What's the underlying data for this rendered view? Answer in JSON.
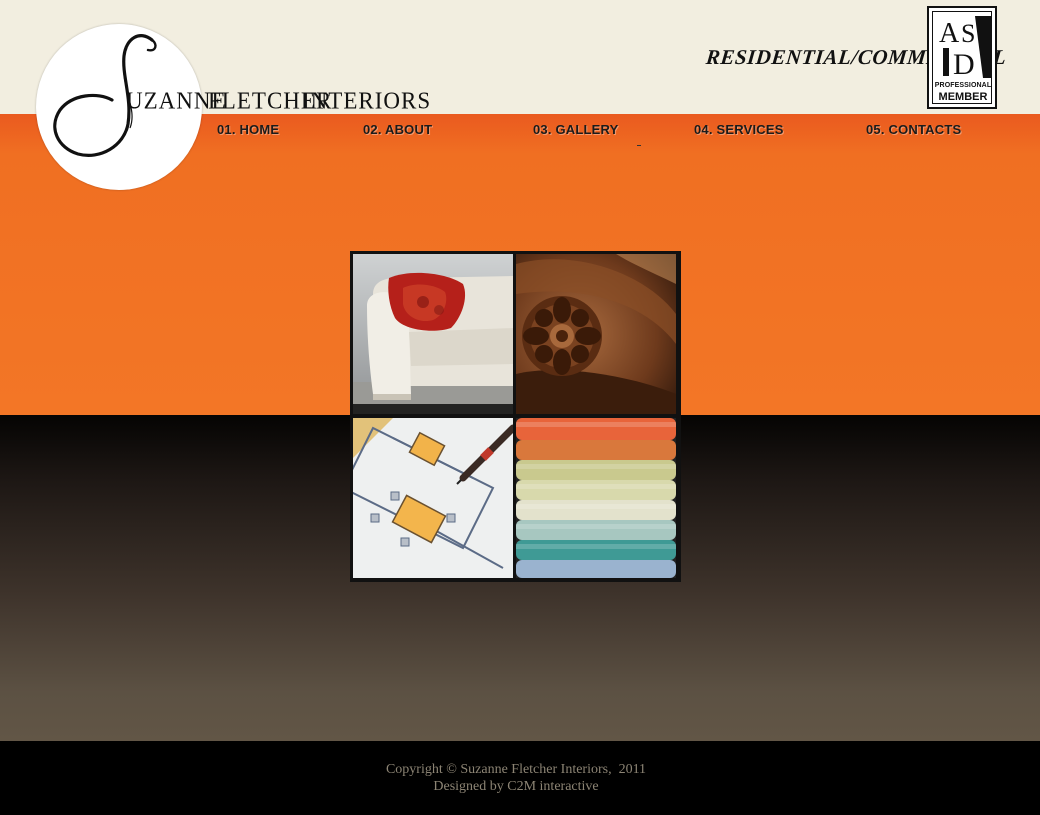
{
  "brand": {
    "word1": "UZANNE",
    "word2": "FLETCHER",
    "word3": "INTERIORS",
    "tagline": "RESIDENTIAL/COMMERCIAL",
    "badge_line1": "PROFESSIONAL",
    "badge_line2": "MEMBER"
  },
  "nav": {
    "items": [
      {
        "label": "01. HOME"
      },
      {
        "label": "02. ABOUT"
      },
      {
        "label": "03. GALLERY"
      },
      {
        "label": "04. SERVICES"
      },
      {
        "label": "05. CONTACTS"
      }
    ]
  },
  "colors": {
    "accent": "#f37626",
    "header_bg": "#f2eee0"
  },
  "gallery": {
    "tiles": [
      {
        "icon": "sofa-photo"
      },
      {
        "icon": "wood-carving-photo"
      },
      {
        "icon": "floor-plan-photo"
      },
      {
        "icon": "fabric-swatches-photo"
      }
    ]
  },
  "footer": {
    "copyright": "Copyright © Suzanne Fletcher Interiors,  2011",
    "designed": "Designed by C2M interactive"
  }
}
